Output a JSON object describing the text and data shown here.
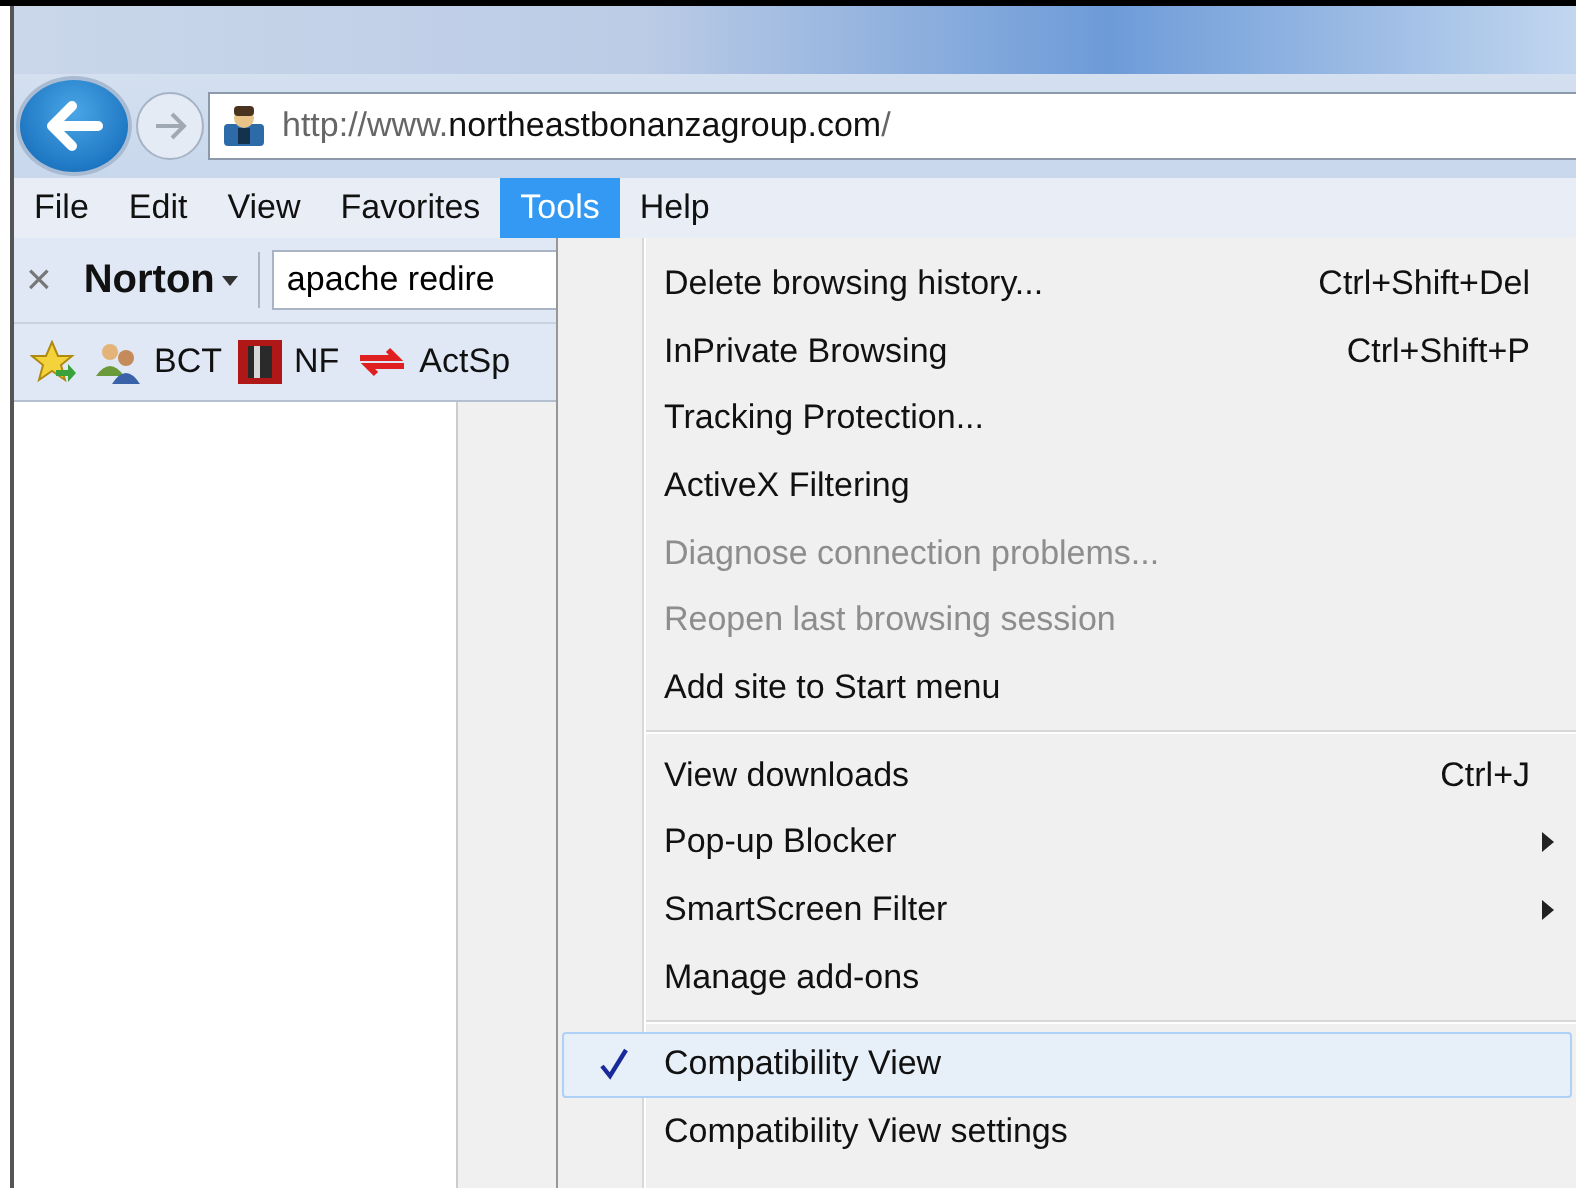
{
  "address_bar": {
    "prefix": "http://www.",
    "domain": "northeastbonanzagroup.com",
    "suffix": "/"
  },
  "menu_bar": [
    {
      "label": "File",
      "selected": false
    },
    {
      "label": "Edit",
      "selected": false
    },
    {
      "label": "View",
      "selected": false
    },
    {
      "label": "Favorites",
      "selected": false
    },
    {
      "label": "Tools",
      "selected": true
    },
    {
      "label": "Help",
      "selected": false
    }
  ],
  "norton_toolbar": {
    "close": "×",
    "brand": "Norton",
    "search_value": "apache redire"
  },
  "favorites_bar": [
    {
      "label": "BCT",
      "kind": "people"
    },
    {
      "label": "NF",
      "kind": "red-square"
    },
    {
      "label": "ActSp",
      "kind": "arrows"
    }
  ],
  "tools_menu": [
    {
      "kind": "item",
      "label": "Delete browsing history...",
      "shortcut": "Ctrl+Shift+Del",
      "disabled": false,
      "submenu": false,
      "checked": false,
      "selected": false
    },
    {
      "kind": "item",
      "label": "InPrivate Browsing",
      "shortcut": "Ctrl+Shift+P",
      "disabled": false,
      "submenu": false,
      "checked": false,
      "selected": false
    },
    {
      "kind": "item",
      "label": "Tracking Protection...",
      "disabled": false,
      "submenu": false,
      "checked": false,
      "selected": false
    },
    {
      "kind": "item",
      "label": "ActiveX Filtering",
      "disabled": false,
      "submenu": false,
      "checked": false,
      "selected": false
    },
    {
      "kind": "item",
      "label": "Diagnose connection problems...",
      "disabled": true,
      "submenu": false,
      "checked": false,
      "selected": false
    },
    {
      "kind": "item",
      "label": "Reopen last browsing session",
      "disabled": true,
      "submenu": false,
      "checked": false,
      "selected": false
    },
    {
      "kind": "item",
      "label": "Add site to Start menu",
      "disabled": false,
      "submenu": false,
      "checked": false,
      "selected": false
    },
    {
      "kind": "separator"
    },
    {
      "kind": "item",
      "label": "View downloads",
      "shortcut": "Ctrl+J",
      "disabled": false,
      "submenu": false,
      "checked": false,
      "selected": false
    },
    {
      "kind": "item",
      "label": "Pop-up Blocker",
      "disabled": false,
      "submenu": true,
      "checked": false,
      "selected": false
    },
    {
      "kind": "item",
      "label": "SmartScreen Filter",
      "disabled": false,
      "submenu": true,
      "checked": false,
      "selected": false
    },
    {
      "kind": "item",
      "label": "Manage add-ons",
      "disabled": false,
      "submenu": false,
      "checked": false,
      "selected": false
    },
    {
      "kind": "separator"
    },
    {
      "kind": "item",
      "label": "Compatibility View",
      "disabled": false,
      "submenu": false,
      "checked": true,
      "selected": true
    },
    {
      "kind": "item",
      "label": "Compatibility View settings",
      "disabled": false,
      "submenu": false,
      "checked": false,
      "selected": false
    }
  ]
}
